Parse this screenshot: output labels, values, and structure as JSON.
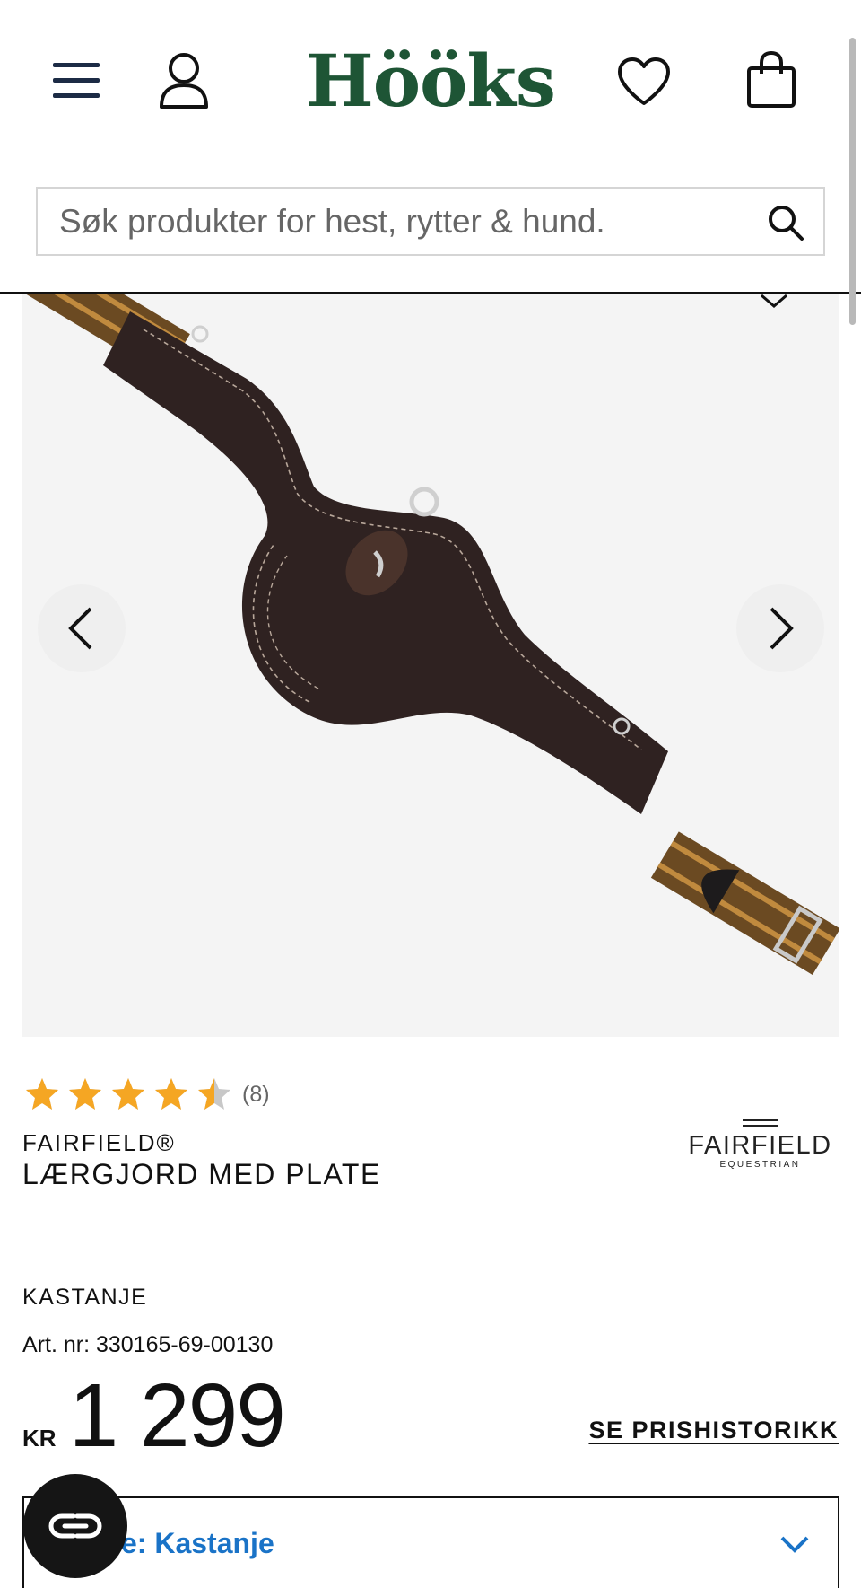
{
  "header": {
    "logo_text": "Hööks",
    "icons": [
      "menu-icon",
      "user-icon",
      "heart-icon",
      "bag-icon"
    ],
    "brand_color": "#1e5535"
  },
  "search": {
    "placeholder": "Søk produkter for hest, rytter & hund.",
    "value": ""
  },
  "gallery": {
    "prev_icon": "chevron-left-icon",
    "next_icon": "chevron-right-icon"
  },
  "product": {
    "rating": 4.5,
    "rating_max": 5,
    "rating_count": "(8)",
    "brand": "FAIRFIELD®",
    "title": "LÆRGJORD MED PLATE",
    "brand_logo": {
      "name": "FAIRFIELD",
      "sub": "EQUESTRIAN"
    },
    "color_name": "KASTANJE",
    "article": "Art. nr: 330165-69-00130",
    "currency": "KR",
    "price": "1 299",
    "price_history_label": "SE PRISHISTORIKK",
    "variant_label": "e: Kastanje",
    "accent_color": "#1a73c7",
    "star_color": "#f5a623"
  }
}
